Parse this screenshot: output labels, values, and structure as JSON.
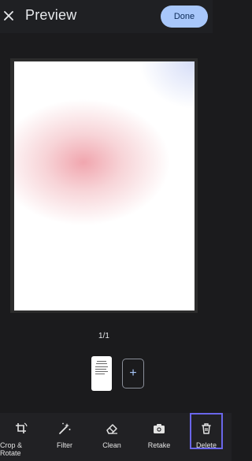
{
  "header": {
    "title": "Preview",
    "done_label": "Done"
  },
  "pager": {
    "counter": "1/1",
    "add_symbol": "+"
  },
  "toolbar": {
    "crop_rotate": "Crop & Rotate",
    "filter": "Filter",
    "clean": "Clean",
    "retake": "Retake",
    "delete": "Delete"
  },
  "icons": {
    "close": "close-icon",
    "crop_rotate": "crop-rotate-icon",
    "filter": "magic-wand-icon",
    "clean": "eraser-icon",
    "retake": "camera-icon",
    "delete": "trash-icon",
    "add": "plus-icon"
  },
  "colors": {
    "done_button": "#a8c7fa",
    "selected_outline": "#6a66ea",
    "background": "#1b1b1d"
  }
}
